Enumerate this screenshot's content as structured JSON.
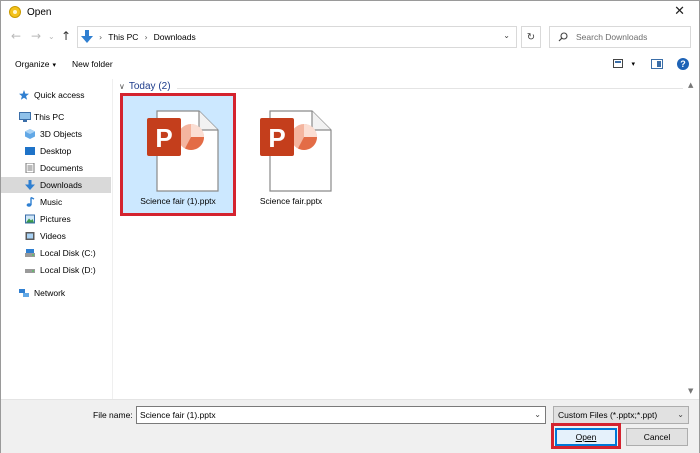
{
  "window": {
    "title": "Open"
  },
  "address": {
    "crumbs": [
      "This PC",
      "Downloads"
    ],
    "search_placeholder": "Search Downloads"
  },
  "toolbar": {
    "organize_label": "Organize",
    "new_folder_label": "New folder"
  },
  "sidebar": {
    "items": [
      {
        "label": "Quick access",
        "icon": "star-icon"
      },
      {
        "label": "This PC",
        "icon": "monitor-icon"
      },
      {
        "label": "3D Objects",
        "icon": "cube-icon"
      },
      {
        "label": "Desktop",
        "icon": "desktop-folder-icon"
      },
      {
        "label": "Documents",
        "icon": "documents-icon"
      },
      {
        "label": "Downloads",
        "icon": "download-arrow-icon",
        "selected": true
      },
      {
        "label": "Music",
        "icon": "music-note-icon"
      },
      {
        "label": "Pictures",
        "icon": "pictures-icon"
      },
      {
        "label": "Videos",
        "icon": "videos-icon"
      },
      {
        "label": "Local Disk (C:)",
        "icon": "drive-icon"
      },
      {
        "label": "Local Disk (D:)",
        "icon": "drive-icon"
      },
      {
        "label": "Network",
        "icon": "network-icon"
      }
    ]
  },
  "content": {
    "group_label": "Today (2)",
    "files": [
      {
        "name": "Science fair (1).pptx",
        "icon": "powerpoint-file-icon",
        "selected": true
      },
      {
        "name": "Science fair.pptx",
        "icon": "powerpoint-file-icon",
        "selected": false
      }
    ]
  },
  "bottom": {
    "file_name_label": "File name:",
    "file_name_value": "Science fair (1).pptx",
    "file_type_value": "Custom Files (*.pptx;*.ppt)",
    "open_label": "Open",
    "cancel_label": "Cancel"
  },
  "colors": {
    "highlight_red": "#d4232f",
    "selection_blue": "#cce8ff",
    "powerpoint_orange": "#c43e1c",
    "accent_blue": "#0078d7"
  }
}
